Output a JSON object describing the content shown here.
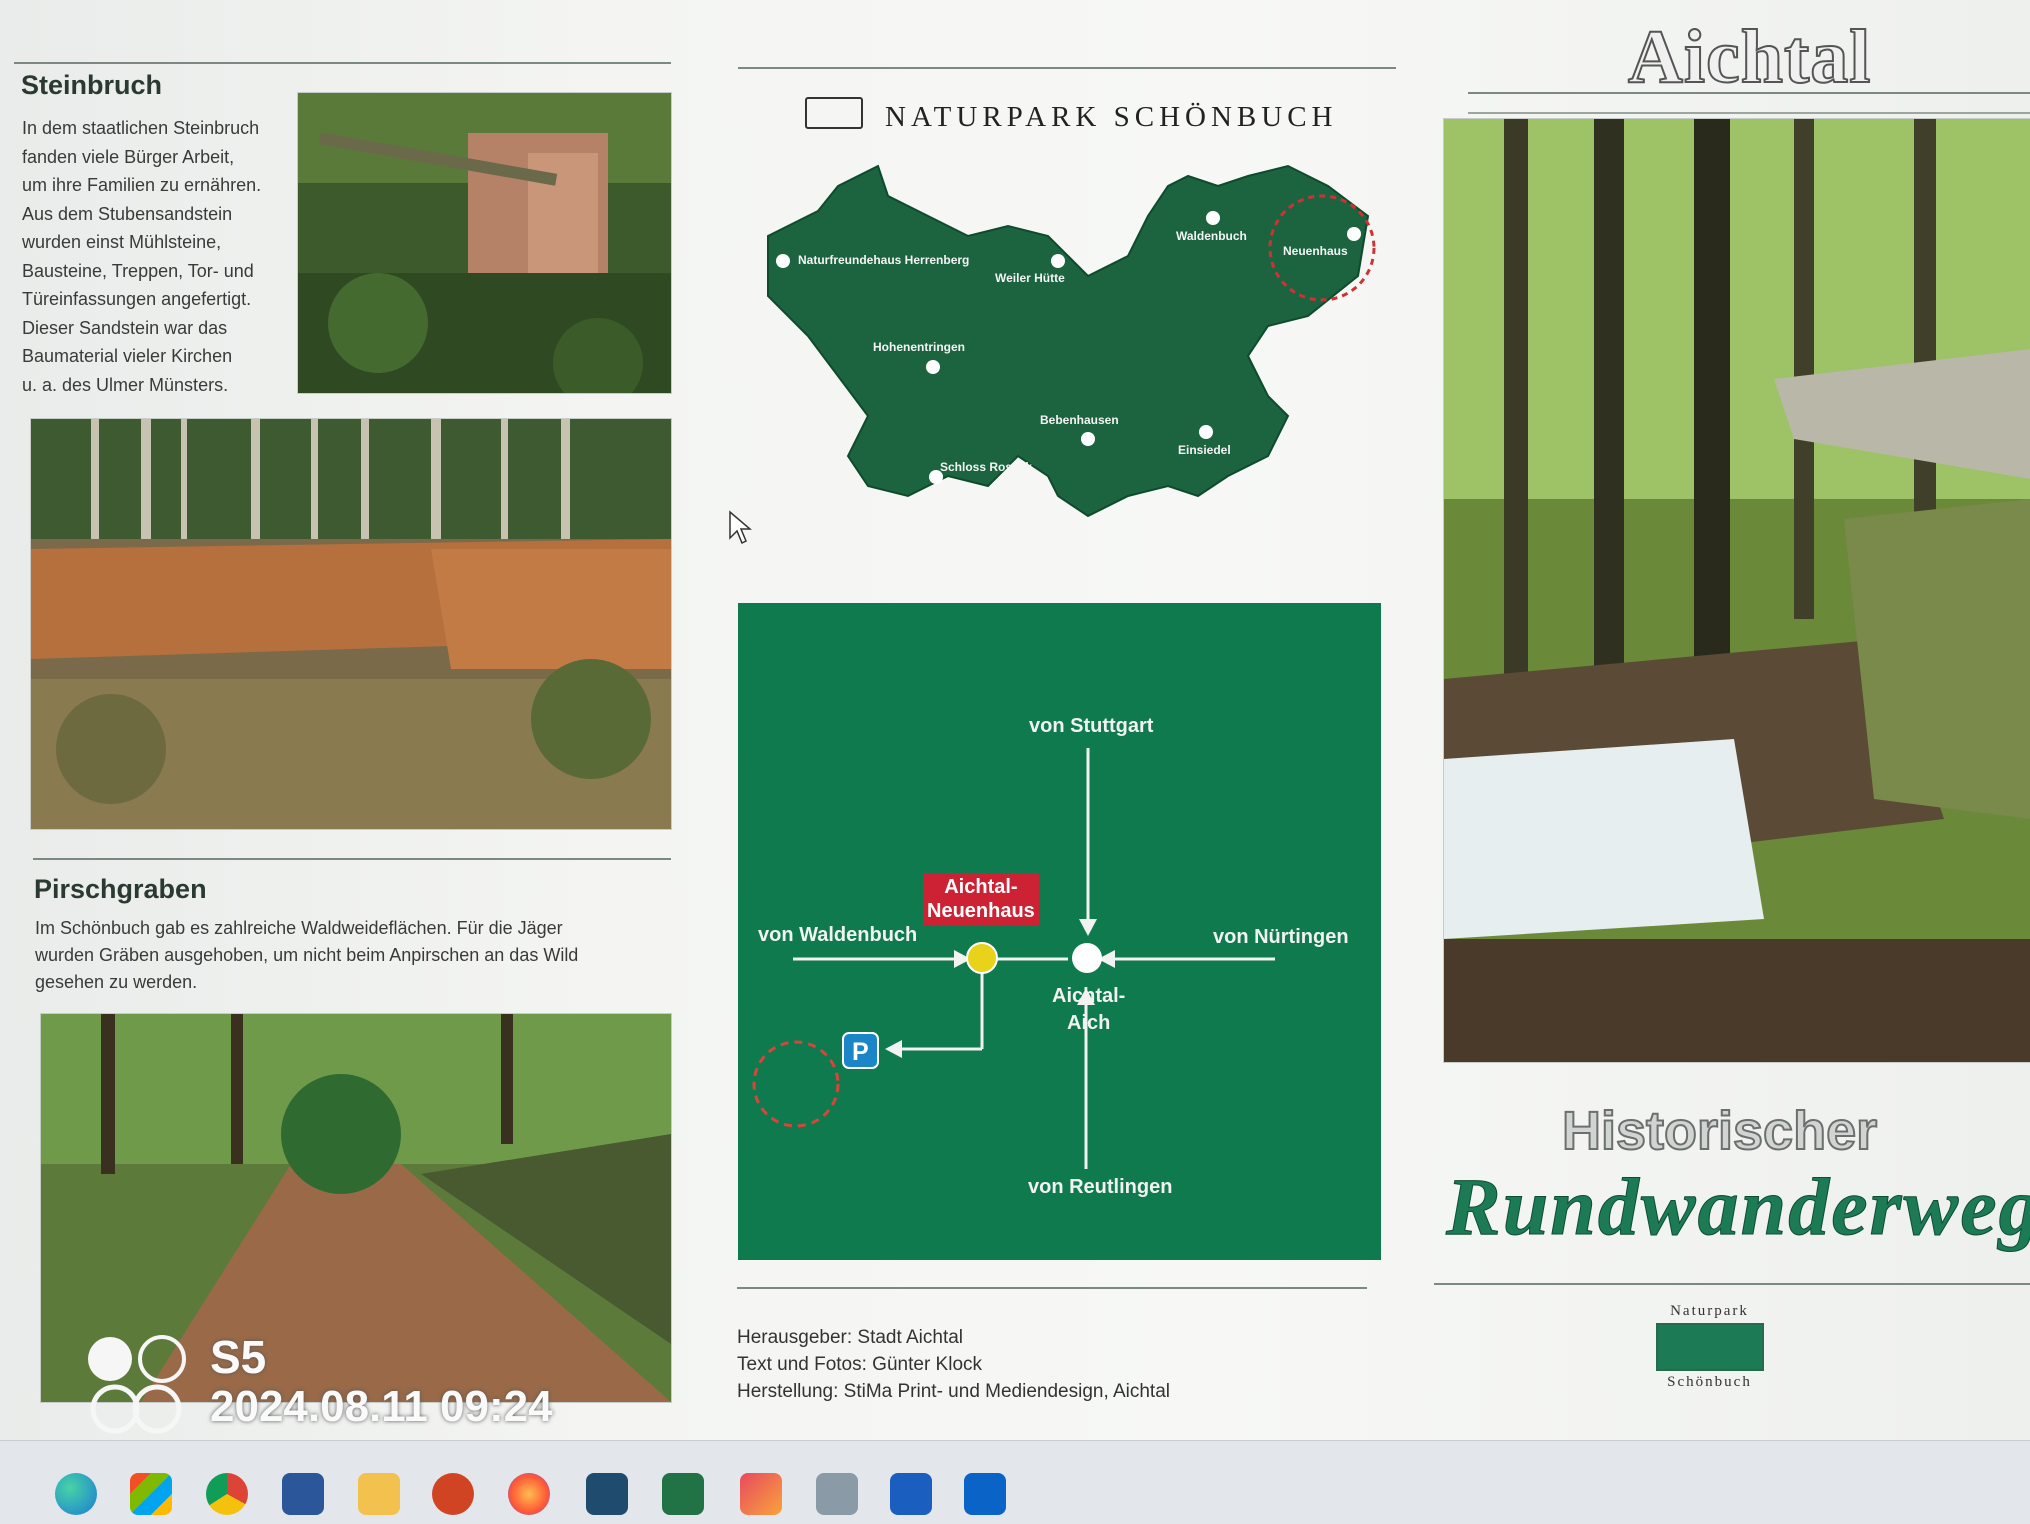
{
  "left": {
    "steinbruch": {
      "title": "Steinbruch",
      "lines": [
        "In dem staatlichen Steinbruch",
        "fanden viele Bürger Arbeit,",
        "um ihre Familien zu ernähren.",
        "Aus dem Stubensandstein",
        "wurden einst Mühlsteine,",
        "Bausteine, Treppen, Tor- und",
        "Türeinfassungen angefertigt.",
        "Dieser Sandstein war das",
        "Baumaterial vieler Kirchen",
        "u. a. des Ulmer Münsters."
      ]
    },
    "pirschgraben": {
      "title": "Pirschgraben",
      "lines": [
        "Im Schönbuch gab es zahlreiche Waldweideflächen. Für die Jäger",
        "wurden Gräben ausgehoben, um nicht beim Anpirschen an das Wild",
        "gesehen zu werden."
      ]
    }
  },
  "middle": {
    "naturpark_title": "NATURPARK SCHÖNBUCH",
    "map_places": [
      "Naturfreundehaus Herrenberg",
      "Weiler Hütte",
      "Waldenbuch",
      "Neuenhaus",
      "Hohenentringen",
      "Bebenhausen",
      "Einsiedel",
      "Schloss Roseck"
    ],
    "route": {
      "from_stuttgart": "von Stuttgart",
      "from_waldenbuch": "von Waldenbuch",
      "from_nuertingen": "von Nürtingen",
      "from_reutlingen": "von Reutlingen",
      "neuenhaus_line1": "Aichtal-",
      "neuenhaus_line2": "Neuenhaus",
      "aich_line1": "Aichtal-",
      "aich_line2": "Aich",
      "parking": "P"
    },
    "credits": [
      "Herausgeber: Stadt Aichtal",
      "Text und Fotos: Günter Klock",
      "Herstellung: StiMa Print- und Mediendesign, Aichtal"
    ]
  },
  "right": {
    "town": "Aichtal",
    "subtitle1": "Historischer",
    "subtitle2": "Rundwanderweg",
    "badge_top": "Naturpark",
    "badge_bottom": "Schönbuch"
  },
  "watermark": {
    "mode": "S5",
    "datetime": "2024.08.11 09:24"
  },
  "taskbar": {
    "icons": [
      "edge-icon",
      "store-icon",
      "chrome-icon",
      "word-icon",
      "explorer-icon",
      "powerpoint-icon",
      "firefox-icon",
      "settings-icon",
      "excel-icon",
      "snipping-icon",
      "photos-icon",
      "scanner-icon",
      "outlook-icon"
    ]
  },
  "colors": {
    "brand_green": "#0e7a4e",
    "highlight_red": "#cc2233",
    "junction_yellow": "#e8d21a",
    "parking_blue": "#1a86c8"
  }
}
